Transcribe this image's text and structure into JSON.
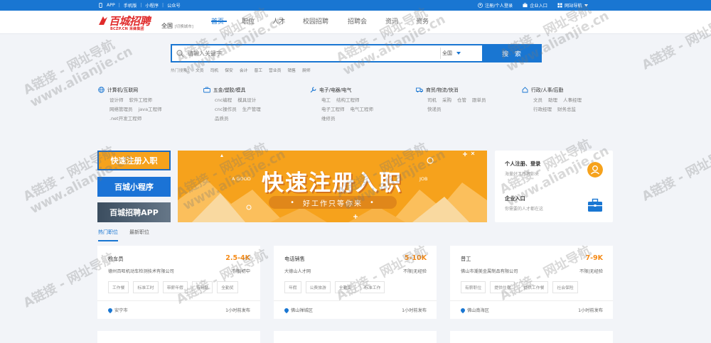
{
  "topbar": {
    "app": "APP",
    "mobile": "手机版",
    "mini": "小程序",
    "official": "公众号",
    "personal_login": "注册/个人登录",
    "company_entry": "企业入口",
    "site_nav": "网站导航"
  },
  "header": {
    "logo_main": "百城招聘",
    "logo_sub": "BCZP.CN 采蜂集团",
    "city": "全国",
    "city_switch": "[切换城市]",
    "nav": [
      "首页",
      "职位",
      "人才",
      "校园招聘",
      "招聘会",
      "资讯",
      "资务"
    ]
  },
  "search": {
    "placeholder": "请输入关键字",
    "city": "全国",
    "button": "搜 索",
    "hot_label": "热门搜索：",
    "hot": [
      "文员",
      "司机",
      "保安",
      "会计",
      "普工",
      "营业员",
      "销售",
      "厨师"
    ]
  },
  "categories": [
    {
      "title": "计算机/互联网",
      "icon": "globe-icon",
      "links": [
        [
          "设计师",
          "软件工程师"
        ],
        [
          "网络管理员",
          "java工程师"
        ],
        [
          ".net开发工程师"
        ]
      ]
    },
    {
      "title": "五金/塑胶/模具",
      "icon": "tools-icon",
      "links": [
        [
          "cnc编程",
          "模具设计"
        ],
        [
          "cnc操作员",
          "生产管理"
        ],
        [
          "品质员"
        ]
      ]
    },
    {
      "title": "电子/电器/电气",
      "icon": "wrench-icon",
      "links": [
        [
          "电工",
          "结构工程师"
        ],
        [
          "电子工程师",
          "电气工程师"
        ],
        [
          "维修员"
        ]
      ]
    },
    {
      "title": "商贸/物流/快消",
      "icon": "truck-icon",
      "links": [
        [
          "司机",
          "采购",
          "仓管",
          "跟单员"
        ],
        [
          "快递员"
        ]
      ]
    },
    {
      "title": "行政/人事/后勤",
      "icon": "home-icon",
      "links": [
        [
          "文员",
          "助理",
          "人事经理"
        ],
        [
          "行政经理",
          "财务总监"
        ]
      ]
    }
  ],
  "side_buttons": [
    "快速注册入职",
    "百城小程序",
    "百城招聘APP"
  ],
  "banner": {
    "left": "A GOOD",
    "right": "JOB",
    "headline": "快速注册入职",
    "slogan": "好工作只等你来"
  },
  "login_panel": {
    "personal_title": "个人注册、登录",
    "personal_sub": "海量好工作等你来",
    "company_title": "企业入口",
    "company_sub": "你需要的人才都在这"
  },
  "tabs": [
    "热门职位",
    "最新职位"
  ],
  "jobs": [
    {
      "title": "检车员",
      "salary": "2.5-4K",
      "company": "德州百旺机动车检测技术有限公司",
      "req": "不限|初中",
      "tags": [
        "工作餐",
        "标准工时",
        "带薪年假",
        "有补贴",
        "全勤奖"
      ],
      "location": "安宁市",
      "time": "1小时前发布"
    },
    {
      "title": "电话销售",
      "salary": "5-10K",
      "company": "大德山人才网",
      "req": "不限|无经验",
      "tags": [
        "年假",
        "公费旅游",
        "全勤奖",
        "标准工作"
      ],
      "location": "佛山禅城区",
      "time": "1小时前发布"
    },
    {
      "title": "普工",
      "salary": "7-9K",
      "company": "佛山市潮美金属制品有限公司",
      "req": "不限|无经验",
      "tags": [
        "有薪职位",
        "提供住宿",
        "提供工作餐",
        "社会保险"
      ],
      "location": "佛山南海区",
      "time": "1小时前发布"
    }
  ],
  "watermark": [
    "A链接 - 网址导航",
    "www.alianjie.cn"
  ],
  "colors": {
    "brand_blue": "#1976d2",
    "orange": "#f6a21c",
    "salary": "#f58a16",
    "logo_red": "#e02b2b"
  }
}
